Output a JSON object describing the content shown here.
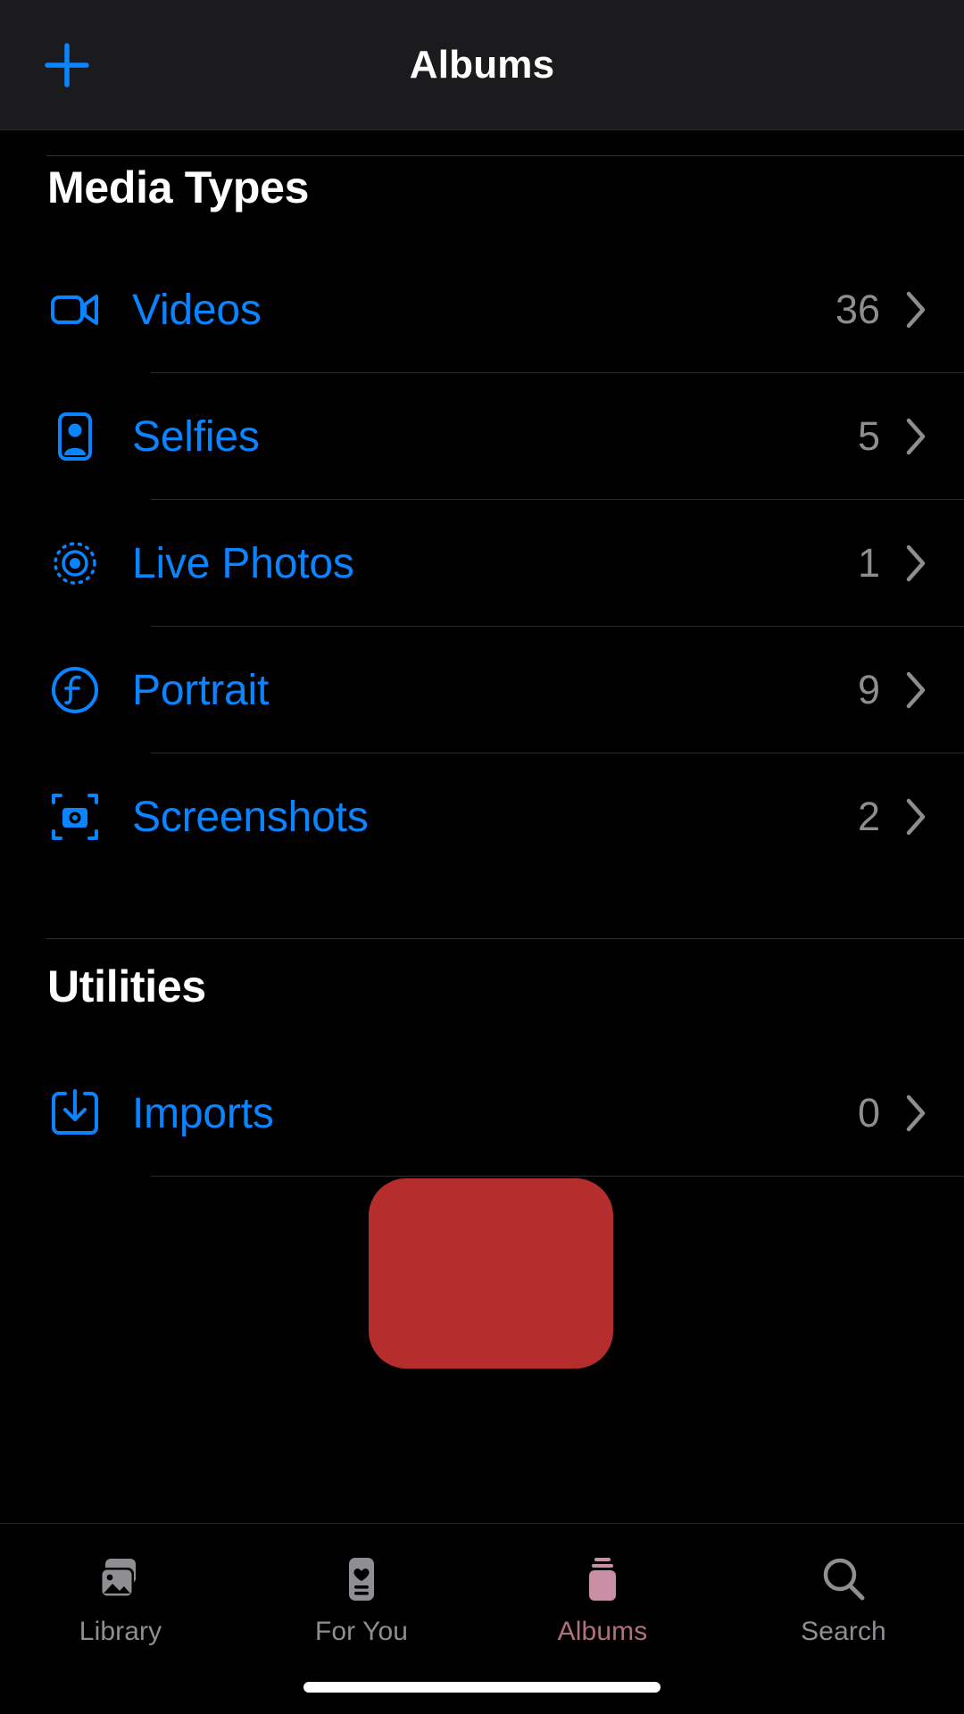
{
  "navbar": {
    "title": "Albums",
    "add_button_icon": "plus-icon",
    "add_button_label": "Add Album"
  },
  "sections": [
    {
      "id": "media-types",
      "title": "Media Types",
      "items": [
        {
          "label": "Videos",
          "count": "36",
          "icon": "video-camera-icon"
        },
        {
          "label": "Selfies",
          "count": "5",
          "icon": "person-portrait-icon"
        },
        {
          "label": "Live Photos",
          "count": "1",
          "icon": "live-photo-icon"
        },
        {
          "label": "Portrait",
          "count": "9",
          "icon": "f-stop-circle-icon"
        },
        {
          "label": "Screenshots",
          "count": "2",
          "icon": "camera-viewfinder-icon"
        }
      ]
    },
    {
      "id": "utilities",
      "title": "Utilities",
      "items": [
        {
          "label": "Imports",
          "count": "0",
          "icon": "download-tray-icon"
        }
      ]
    }
  ],
  "tabbar": {
    "tabs": [
      {
        "label": "Library",
        "icon": "photo-stack-icon",
        "active": false
      },
      {
        "label": "For You",
        "icon": "heart-card-icon",
        "active": false
      },
      {
        "label": "Albums",
        "icon": "albums-stack-icon",
        "active": true
      },
      {
        "label": "Search",
        "icon": "magnifier-icon",
        "active": false
      }
    ]
  },
  "colors": {
    "accent_blue": "#0a84ff",
    "secondary_gray": "#8d8d92",
    "background": "#000000",
    "navbar_background": "#1b1b1d",
    "highlight_red": "#b52d2d",
    "active_tab_label": "#b07080"
  },
  "highlight": {
    "target": "Albums",
    "shape": "rounded-rectangle"
  }
}
